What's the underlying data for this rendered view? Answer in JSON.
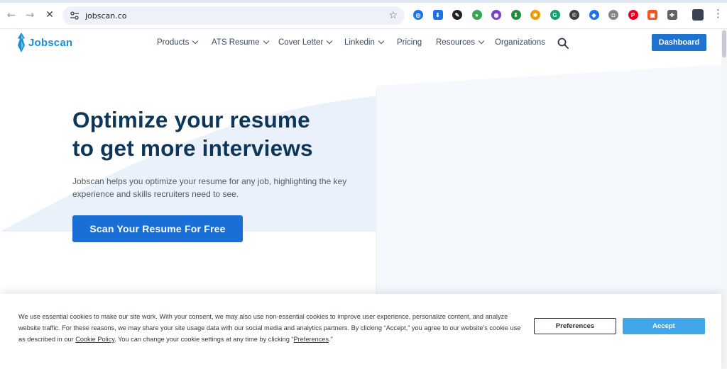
{
  "browser": {
    "url": "jobscan.co",
    "back_glyph": "←",
    "forward_glyph": "→",
    "stop_glyph": "✕",
    "star_glyph": "☆",
    "menu_glyph": "⋮",
    "extensions": [
      {
        "name": "ext-compass-icon",
        "color": "#1a73e8",
        "glyph": "◎"
      },
      {
        "name": "ext-download-icon",
        "color": "#1a73e8",
        "glyph": "⬇"
      },
      {
        "name": "ext-eyedropper-icon",
        "color": "#202124",
        "glyph": "✎"
      },
      {
        "name": "ext-circle-green-icon",
        "color": "#34a853",
        "glyph": "●"
      },
      {
        "name": "ext-purple-icon",
        "color": "#7b3fc4",
        "glyph": "◉"
      },
      {
        "name": "ext-green-arrow-icon",
        "color": "#1e8e3e",
        "glyph": "⬇"
      },
      {
        "name": "ext-gear-orange-icon",
        "color": "#f29900",
        "glyph": "✱"
      },
      {
        "name": "ext-grammarly-icon",
        "color": "#15a06b",
        "glyph": "G"
      },
      {
        "name": "ext-copyright-icon",
        "color": "#3c4043",
        "glyph": "©"
      },
      {
        "name": "ext-tag-icon",
        "color": "#1a73e8",
        "glyph": "◆"
      },
      {
        "name": "ext-camera-icon",
        "color": "#80868b",
        "glyph": "◘"
      },
      {
        "name": "ext-pinterest-icon",
        "color": "#e60023",
        "glyph": "P"
      },
      {
        "name": "ext-orange-square-icon",
        "color": "#f4511e",
        "glyph": "▣"
      },
      {
        "name": "ext-puzzle-icon",
        "color": "#5f6368",
        "glyph": "✚"
      }
    ]
  },
  "site": {
    "logo_text": "Jobscan",
    "brand_color": "#1d8fd6",
    "nav": [
      {
        "label": "Products",
        "has_caret": true
      },
      {
        "label": "ATS Resume",
        "has_caret": true
      },
      {
        "label": "Cover Letter",
        "has_caret": true
      },
      {
        "label": "Linkedin",
        "has_caret": true
      },
      {
        "label": "Pricing",
        "has_caret": false
      },
      {
        "label": "Resources",
        "has_caret": true
      },
      {
        "label": "Organizations",
        "has_caret": false
      }
    ],
    "dashboard_label": "Dashboard"
  },
  "hero": {
    "headline_line1": "Optimize your resume",
    "headline_line2": "to get more interviews",
    "subtext": "Jobscan helps you optimize your resume for any job, highlighting the key experience and skills recruiters need to see.",
    "cta_label": "Scan Your Resume For Free",
    "headline_color": "#0d3659",
    "cta_color": "#1a6fd6"
  },
  "cookie_banner": {
    "text_before_link": "We use essential cookies to make our site work. With your consent, we may also use non-essential cookies to improve user experience, personalize content, and analyze website traffic. For these reasons, we may share your site usage data with our social media and analytics partners. By clicking “Accept,” you agree to our website's cookie use as described in our ",
    "cookie_policy_link": "Cookie Policy",
    "text_after_link": ". You can change your cookie settings at any time by clicking “",
    "preferences_link": "Preferences",
    "text_end": ".”",
    "preferences_button": "Preferences",
    "accept_button": "Accept",
    "accept_color": "#3fa6ea"
  }
}
